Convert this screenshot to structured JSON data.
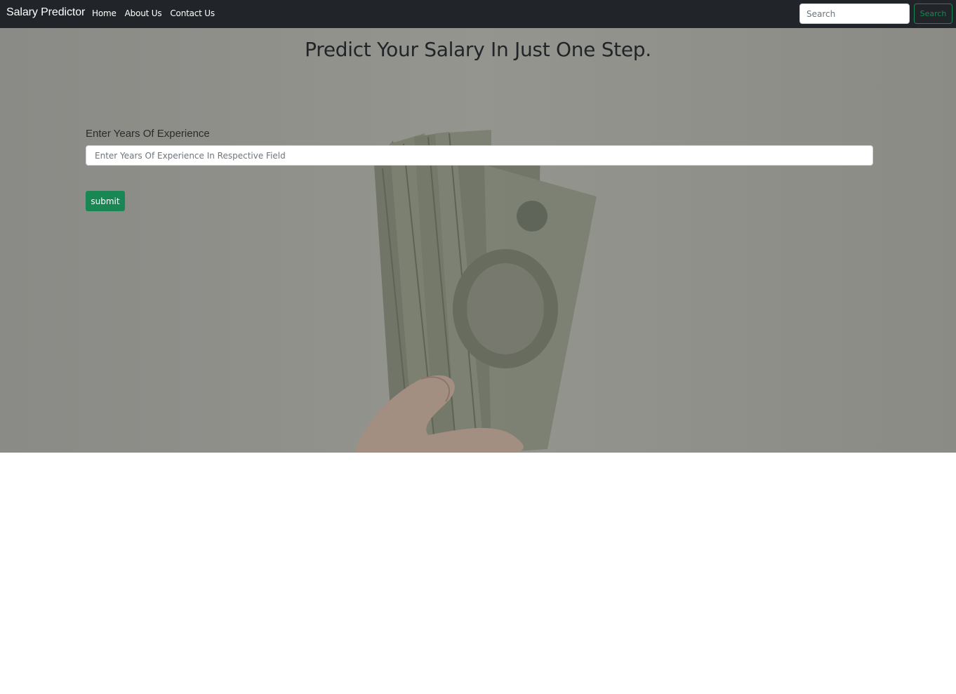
{
  "nav": {
    "brand": "Salary Predictor",
    "links": [
      {
        "label": "Home"
      },
      {
        "label": "About Us"
      },
      {
        "label": "Contact Us"
      }
    ],
    "search": {
      "placeholder": "Search",
      "value": ""
    },
    "search_button": "Search"
  },
  "hero": {
    "headline": "Predict Your Salary In Just One Step.",
    "form": {
      "label": "Enter Years Of Experience",
      "input_placeholder": "Enter Years Of Experience In Respective Field",
      "input_value": "",
      "submit_label": "submit"
    }
  },
  "colors": {
    "navbar_bg": "#212529",
    "accent_green": "#198754",
    "hero_overlay": "#8f8f8a"
  },
  "icons": {
    "background": "cash-in-hand-photo"
  }
}
